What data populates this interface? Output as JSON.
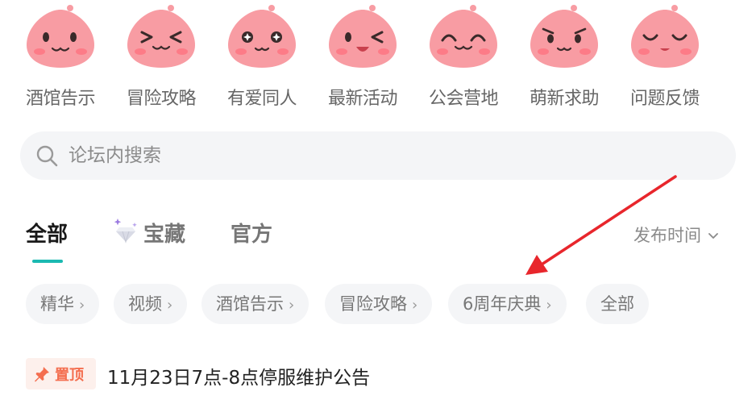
{
  "categories": [
    {
      "label": "酒馆告示",
      "icon": "peach-mascot-smile-icon"
    },
    {
      "label": "冒险攻略",
      "icon": "peach-mascot-squint-icon"
    },
    {
      "label": "有爱同人",
      "icon": "peach-mascot-sparkle-eyes-icon"
    },
    {
      "label": "最新活动",
      "icon": "peach-mascot-wink-icon"
    },
    {
      "label": "公会营地",
      "icon": "peach-mascot-happy-icon"
    },
    {
      "label": "萌新求助",
      "icon": "peach-mascot-determined-icon"
    },
    {
      "label": "问题反馈",
      "icon": "peach-mascot-closed-eyes-icon"
    }
  ],
  "search": {
    "placeholder": "论坛内搜索"
  },
  "tabs": [
    {
      "label": "全部",
      "active": true
    },
    {
      "label": "宝藏",
      "active": false
    },
    {
      "label": "官方",
      "active": false
    }
  ],
  "sort": {
    "label": "发布时间"
  },
  "chips": [
    {
      "label": "精华",
      "has_arrow": true
    },
    {
      "label": "视频",
      "has_arrow": true
    },
    {
      "label": "酒馆告示",
      "has_arrow": true
    },
    {
      "label": "冒险攻略",
      "has_arrow": true
    },
    {
      "label": "6周年庆典",
      "has_arrow": true
    },
    {
      "label": "全部",
      "has_arrow": false
    }
  ],
  "pinned_post": {
    "badge": "置顶",
    "title": "11月23日7点-8点停服维护公告"
  },
  "colors": {
    "accent": "#1bb9b1",
    "mascot_fill": "#f89ca3",
    "pin_color": "#f46e4f",
    "annotation_arrow": "#e8262c"
  },
  "annotation": {
    "type": "red-arrow",
    "points_to": "6周年庆典"
  }
}
